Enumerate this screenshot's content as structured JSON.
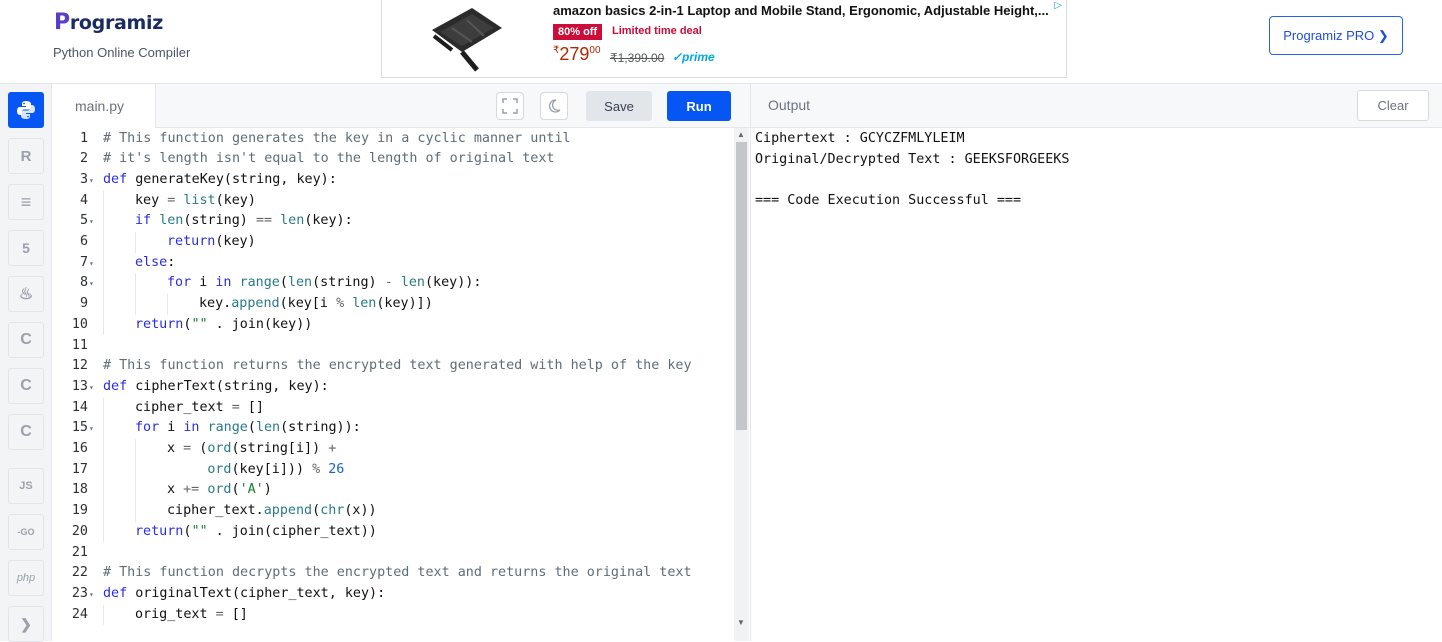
{
  "header": {
    "logo_text": "rogramiz",
    "logo_p": "P",
    "subtitle": "Python Online Compiler",
    "pro_button": "Programiz PRO ❯"
  },
  "ad": {
    "title": "amazon basics 2-in-1 Laptop and Mobile Stand, Ergonomic, Adjustable Height,...",
    "badge": "80% off",
    "deal": "Limited time deal",
    "price_symbol": "₹",
    "price": "279",
    "price_decimal": "00",
    "mrp": "₹1,399.00",
    "prime": "✓prime",
    "info_icon": "ad-info-icon"
  },
  "languages": [
    {
      "name": "python",
      "label": "Py",
      "active": true
    },
    {
      "name": "r",
      "label": "R"
    },
    {
      "name": "sql",
      "label": "≡"
    },
    {
      "name": "html",
      "label": "5"
    },
    {
      "name": "java",
      "label": "♨"
    },
    {
      "name": "c",
      "label": "C"
    },
    {
      "name": "cpp",
      "label": "C"
    },
    {
      "name": "csharp",
      "label": "C"
    },
    {
      "name": "js",
      "label": "JS"
    },
    {
      "name": "go",
      "label": "-GO"
    },
    {
      "name": "php",
      "label": "php"
    },
    {
      "name": "swift",
      "label": "❯"
    }
  ],
  "editor": {
    "tab_name": "main.py",
    "save_label": "Save",
    "run_label": "Run"
  },
  "code_lines": [
    {
      "n": "1",
      "fold": false,
      "indent": 0,
      "html": "<span class='cm'># This function generates the key in a cyclic manner until</span>"
    },
    {
      "n": "2",
      "fold": false,
      "indent": 0,
      "html": "<span class='cm'># it's length isn't equal to the length of original text</span>"
    },
    {
      "n": "3",
      "fold": true,
      "indent": 0,
      "html": "<span class='kw'>def</span> generateKey(string, key):"
    },
    {
      "n": "4",
      "fold": false,
      "indent": 1,
      "html": "key <span class='op'>=</span> <span class='bi'>list</span>(key)"
    },
    {
      "n": "5",
      "fold": true,
      "indent": 1,
      "html": "<span class='kw'>if</span> <span class='bi'>len</span>(string) <span class='op'>==</span> <span class='bi'>len</span>(key):"
    },
    {
      "n": "6",
      "fold": false,
      "indent": 2,
      "html": "<span class='kw'>return</span>(key)"
    },
    {
      "n": "7",
      "fold": true,
      "indent": 1,
      "html": "<span class='kw'>else</span>:"
    },
    {
      "n": "8",
      "fold": true,
      "indent": 2,
      "html": "<span class='kw'>for</span> i <span class='kw'>in</span> <span class='bi'>range</span>(<span class='bi'>len</span>(string) <span class='op'>-</span> <span class='bi'>len</span>(key)):"
    },
    {
      "n": "9",
      "fold": false,
      "indent": 3,
      "html": "key.<span class='bi'>append</span>(key[i <span class='op'>%</span> <span class='bi'>len</span>(key)])"
    },
    {
      "n": "10",
      "fold": false,
      "indent": 1,
      "html": "<span class='kw'>return</span>(<span class='str'>\"\"</span> . join(key))"
    },
    {
      "n": "11",
      "fold": false,
      "indent": 0,
      "html": ""
    },
    {
      "n": "12",
      "fold": false,
      "indent": 0,
      "html": "<span class='cm'># This function returns the encrypted text generated with help of the key</span>"
    },
    {
      "n": "13",
      "fold": true,
      "indent": 0,
      "html": "<span class='kw'>def</span> cipherText(string, key):"
    },
    {
      "n": "14",
      "fold": false,
      "indent": 1,
      "html": "cipher_text <span class='op'>=</span> []"
    },
    {
      "n": "15",
      "fold": true,
      "indent": 1,
      "html": "<span class='kw'>for</span> i <span class='kw'>in</span> <span class='bi'>range</span>(<span class='bi'>len</span>(string)):"
    },
    {
      "n": "16",
      "fold": false,
      "indent": 2,
      "html": "x <span class='op'>=</span> (<span class='bi'>ord</span>(string[i]) <span class='op'>+</span>"
    },
    {
      "n": "17",
      "fold": false,
      "indent": 2,
      "html": "     <span class='bi'>ord</span>(key[i])) <span class='op'>%</span> <span class='num'>26</span>"
    },
    {
      "n": "18",
      "fold": false,
      "indent": 2,
      "html": "x <span class='op'>+=</span> <span class='bi'>ord</span>(<span class='str'>'A'</span>)"
    },
    {
      "n": "19",
      "fold": false,
      "indent": 2,
      "html": "cipher_text.<span class='bi'>append</span>(<span class='bi'>chr</span>(x))"
    },
    {
      "n": "20",
      "fold": false,
      "indent": 1,
      "html": "<span class='kw'>return</span>(<span class='str'>\"\"</span> . join(cipher_text))"
    },
    {
      "n": "21",
      "fold": false,
      "indent": 0,
      "html": ""
    },
    {
      "n": "22",
      "fold": false,
      "indent": 0,
      "html": "<span class='cm'># This function decrypts the encrypted text and returns the original text</span>"
    },
    {
      "n": "23",
      "fold": true,
      "indent": 0,
      "html": "<span class='kw'>def</span> originalText(cipher_text, key):"
    },
    {
      "n": "24",
      "fold": false,
      "indent": 1,
      "html": "orig_text <span class='op'>=</span> []"
    }
  ],
  "output": {
    "title": "Output",
    "clear_label": "Clear",
    "lines": [
      "Ciphertext : GCYCZFMLYLEIM",
      "Original/Decrypted Text : GEEKSFORGEEKS",
      "",
      "=== Code Execution Successful ==="
    ]
  }
}
